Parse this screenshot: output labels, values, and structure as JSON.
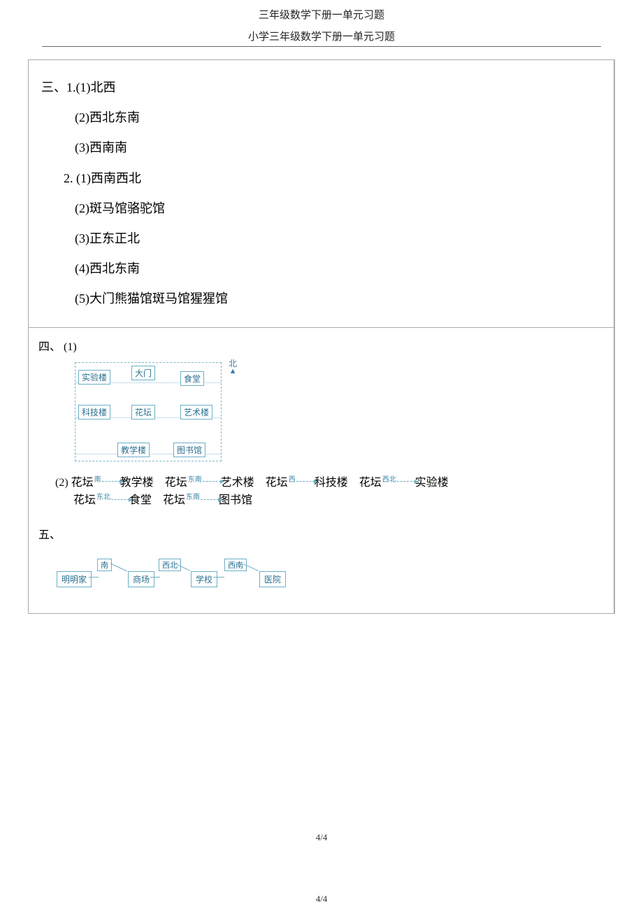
{
  "header": {
    "title1": "三年级数学下册一单元习题",
    "title2": "小学三年级数学下册一单元习题"
  },
  "section3": {
    "label": "三、",
    "q1": {
      "prefix": "1.",
      "items": [
        "(1)北西",
        "(2)西北东南",
        "(3)西南南"
      ]
    },
    "q2": {
      "prefix": "2.",
      "items": [
        "(1)西南西北",
        "(2)斑马馆骆驼馆",
        "(3)正东正北",
        "(4)西北东南",
        "(5)大门熊猫馆斑马馆猩猩馆"
      ]
    }
  },
  "section4": {
    "label": "四、",
    "q1_label": "(1)",
    "north": "北",
    "buildings": {
      "shiyanlou": "实验楼",
      "damen": "大门",
      "shitang": "食堂",
      "kejilou": "科技楼",
      "huatan": "花坛",
      "yishulou": "艺术楼",
      "jiaoxuelou": "教学楼",
      "tushuguan": "图书馆"
    },
    "q2": {
      "prefix": "(2)",
      "pairs_line1": [
        {
          "from": "花坛",
          "dir": "南",
          "to": "教学楼"
        },
        {
          "from": "花坛",
          "dir": "东南",
          "to": "艺术楼"
        },
        {
          "from": "花坛",
          "dir": "西",
          "to": "科技楼"
        },
        {
          "from": "花坛",
          "dir": "西北",
          "to": "实验楼"
        }
      ],
      "pairs_line2": [
        {
          "from": "花坛",
          "dir": "东北",
          "to": "食堂"
        },
        {
          "from": "花坛",
          "dir": "东南",
          "to": "图书馆"
        }
      ]
    }
  },
  "section5": {
    "label": "五、",
    "nodes": [
      "明明家",
      "商场",
      "学校",
      "医院"
    ],
    "dirs": [
      "南",
      "西北",
      "西南"
    ]
  },
  "footer": {
    "page": "4/4"
  }
}
